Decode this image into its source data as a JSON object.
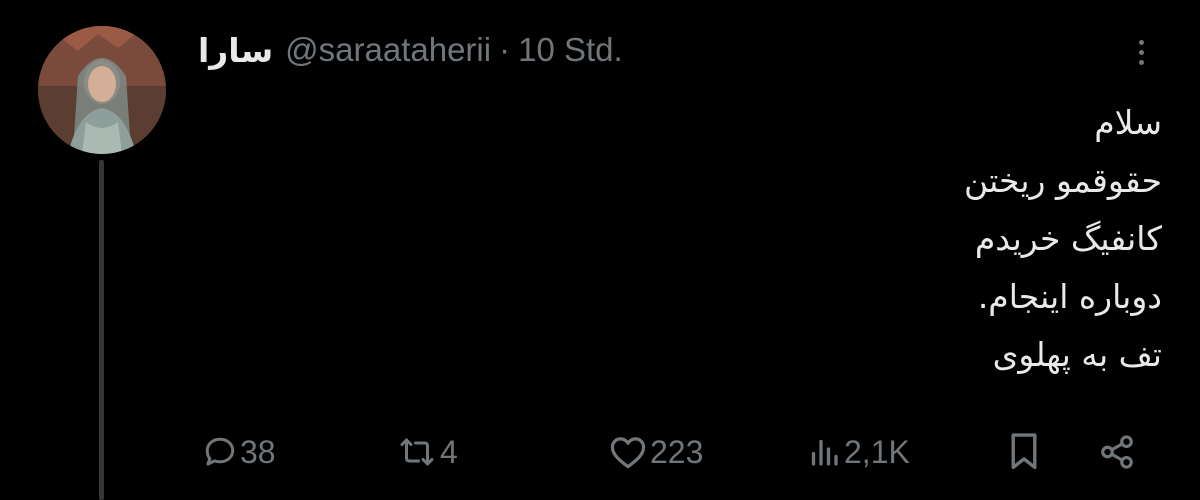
{
  "tweet": {
    "display_name": "سارا",
    "handle": "@saraataherii",
    "separator": "·",
    "time": "10 Std.",
    "lines": [
      "سلام",
      "حقوقمو ریختن",
      "کانفیگ خریدم",
      "دوباره اینجام.",
      "تف به پهلوی"
    ]
  },
  "actions": {
    "replies": "38",
    "reposts": "4",
    "likes": "223",
    "views": "2,1K"
  },
  "icons": {
    "more": "more-dots-icon",
    "reply": "reply-bubble-icon",
    "repost": "repost-arrows-icon",
    "like": "heart-icon",
    "views": "bar-chart-icon",
    "bookmark": "bookmark-icon",
    "share": "share-icon"
  },
  "colors": {
    "background": "#000000",
    "text": "#e7e9ea",
    "secondary": "#71767b",
    "thread_line": "#333639"
  }
}
